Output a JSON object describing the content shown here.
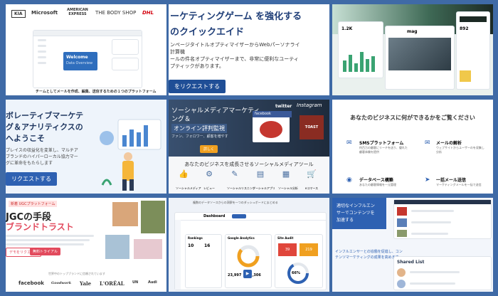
{
  "tile1": {
    "logos": [
      "KIA",
      "Microsoft",
      "AMERICAN EXPRESS",
      "THE BODY SHOP",
      "DHL"
    ],
    "welcome": "Welcome",
    "data_overview": "Data Overview",
    "caption": "チームとしてメールを作成、編集、送信するための１つのプラットフォーム"
  },
  "tile2": {
    "headline_1": "ーケティングゲーム を強化する",
    "headline_2": "のクイックエイド",
    "body_1": "ンページタイトルオプティマイザーからWebパーソナライ",
    "body_2": "計算機",
    "body_3": "ールの件名オプティマイザーまで、非常に便利なユーティ",
    "body_4": "プティックがあります。",
    "cta": "をリクエストする"
  },
  "tile3": {
    "magazine_title": "mag",
    "stat_1": "1.2K",
    "stat_2": "892"
  },
  "tile4": {
    "headline_1": "ボレーティブマーケテ",
    "headline_2": "グ＆アナリティクスの",
    "headline_3": "へようこそ",
    "body_1": "プレイスの収益化を変革し、マルチア",
    "body_2": "ブランドのハイパーローカル協力マー",
    "body_3": "グに革命をもたらします",
    "cta": "リクエストする"
  },
  "tile5": {
    "headline_1": "ソーシャルメディアマーケティ",
    "headline_2": "ング＆",
    "headline_3": "オンライン評判監視",
    "subline": "ファン、フォロワー、顧客を増やす",
    "cta": "詳しく",
    "brand_facebook": "facebook",
    "brand_twitter": "twitter",
    "brand_instagram": "Instagram",
    "brand_toast": "TOAST",
    "subtitle": "あなたのビジネスを成長させるソーシャルメディアツール",
    "tools": [
      "ソーシャルメディア",
      "レビュー",
      "ソーシャルリスニング",
      "ソーシャルアプリ",
      "ソーシャル分析",
      "eコマース"
    ]
  },
  "tile6": {
    "title_1": "あなたのビジネスに何ができるかをご覧ください",
    "features": [
      {
        "title": "SMSプラットフォーム",
        "desc": "何百万の顧客にリーチを送り、優れた顧客体験を提供"
      },
      {
        "title": "メールの解析",
        "desc": "ウェブサイトからユーザーのを収集し分析"
      },
      {
        "title": "データベース構築",
        "desc": "あなたの顧客情報を一元管理"
      },
      {
        "title": "一括メール送信",
        "desc": "マーケティングメールを一括で送信"
      }
    ]
  },
  "tile7": {
    "badge": "新着 UGCプラットフォーム",
    "headline_1": "JGCの手段",
    "headline_2": "ブランドトラスト",
    "cta_primary": "デモをリクエスト",
    "cta_secondary": "無料トライアル",
    "trusted_by": "世界中のトップブランドに信頼されています",
    "logos": [
      "facebook",
      "Goodwork",
      "Yale",
      "L'ORÉAL",
      "UN",
      "Audi"
    ]
  },
  "tile8": {
    "top_text": "複数のデータソースからの洞察を一つのダッシュボードにまとめる",
    "app_name": "Dashboard",
    "panels": [
      "Rankings",
      "Google Analytics",
      "Site Audit"
    ],
    "numbers": [
      "10",
      "16",
      "23,997",
      "3,306",
      "39",
      "219"
    ],
    "gauge": "66%"
  },
  "tile9": {
    "blue_text_1": "適切なインフルエン",
    "blue_text_2": "サーでコンテンツを",
    "blue_text_3": "加速する",
    "body_1": "インフルエンサーとの協働を促進し、コン",
    "body_2": "テンツマーケティングの成果を高めます",
    "shared_list": "Shared List"
  }
}
